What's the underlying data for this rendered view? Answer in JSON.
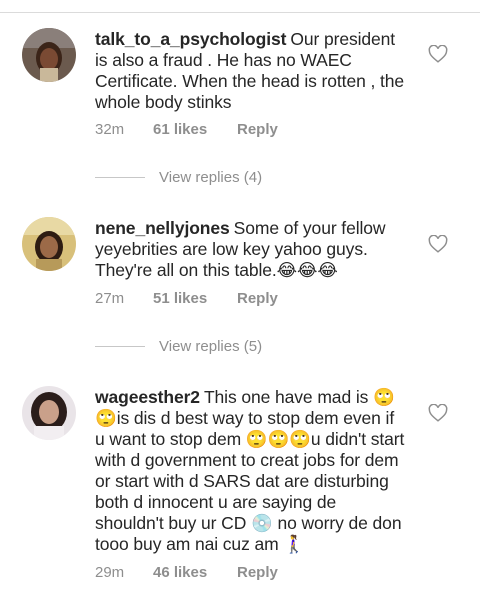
{
  "comments": [
    {
      "username": "talk_to_a_psychologist",
      "text": "Our president is also a fraud . He has no WAEC Certificate.  When the head is rotten , the whole body stinks",
      "time": "32m",
      "likes": "61 likes",
      "reply": "Reply",
      "view_replies": "View replies (4)"
    },
    {
      "username": "nene_nellyjones",
      "text": "Some of your fellow yeyebrities are low key yahoo guys. They're all on this table.😂😂😂",
      "time": "27m",
      "likes": "51 likes",
      "reply": "Reply",
      "view_replies": "View replies (5)"
    },
    {
      "username": "wageesther2",
      "text": "This one have mad is 🙄🙄is dis d best way to stop dem even if u want to stop dem 🙄🙄🙄u didn't start with d government to creat jobs for dem or start with d SARS dat are disturbing both d innocent u are saying de shouldn't buy ur CD 💿 no worry de don tooo buy am nai cuz am 🚶‍♀️",
      "time": "29m",
      "likes": "46 likes",
      "reply": "Reply"
    }
  ],
  "colors": {
    "text": "#262626",
    "meta": "#8e8e8e",
    "divider": "#dbdbdb"
  },
  "icons": {
    "like": "heart-outline-icon"
  }
}
